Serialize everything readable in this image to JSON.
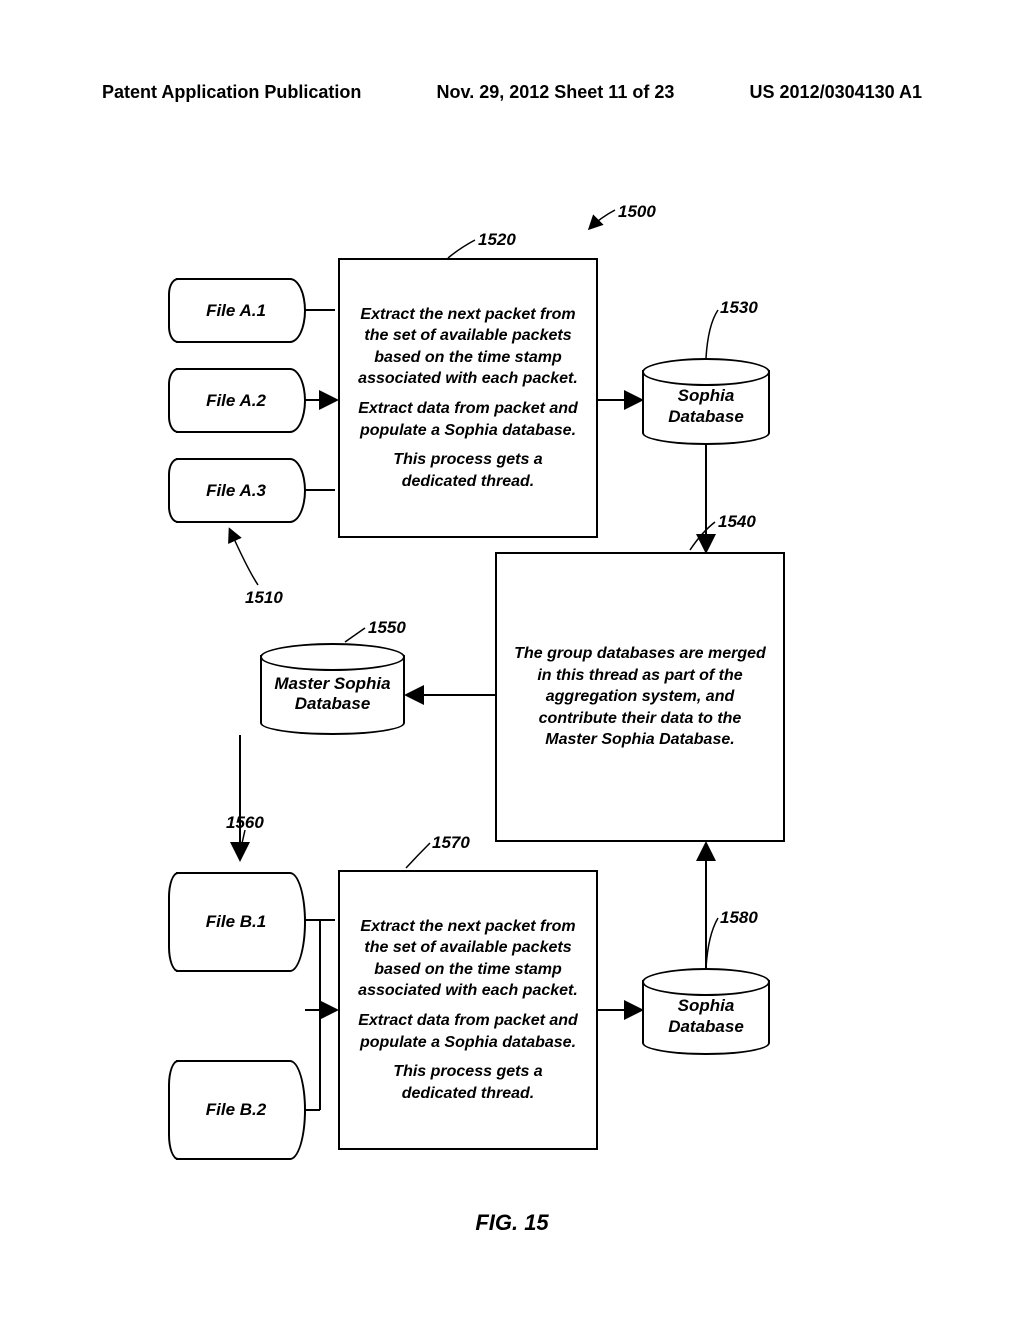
{
  "header": {
    "left": "Patent Application Publication",
    "center": "Nov. 29, 2012  Sheet 11 of 23",
    "right": "US 2012/0304130 A1"
  },
  "files_a": [
    "File A.1",
    "File A.2",
    "File A.3"
  ],
  "files_b": [
    "File B.1",
    "File B.2"
  ],
  "proc_a": {
    "p1": "Extract the next packet from the set of available packets based on the time stamp associated with each packet.",
    "p2": "Extract data from packet and populate a Sophia database.",
    "p3": "This process gets a dedicated thread."
  },
  "proc_b": {
    "p1": "Extract the next packet from the set of available packets based on the time stamp associated with each packet.",
    "p2": "Extract data from packet and populate a Sophia database.",
    "p3": "This process gets a dedicated thread."
  },
  "merge": {
    "p1": "The group databases are merged in this thread as part of the aggregation system, and contribute their data to the Master Sophia Database."
  },
  "db": {
    "sophia_a": "Sophia Database",
    "sophia_b": "Sophia Database",
    "master": "Master Sophia Database"
  },
  "refs": {
    "1500": "1500",
    "1510": "1510",
    "1520": "1520",
    "1530": "1530",
    "1540": "1540",
    "1550": "1550",
    "1560": "1560",
    "1570": "1570",
    "1580": "1580"
  },
  "figure": "FIG. 15"
}
